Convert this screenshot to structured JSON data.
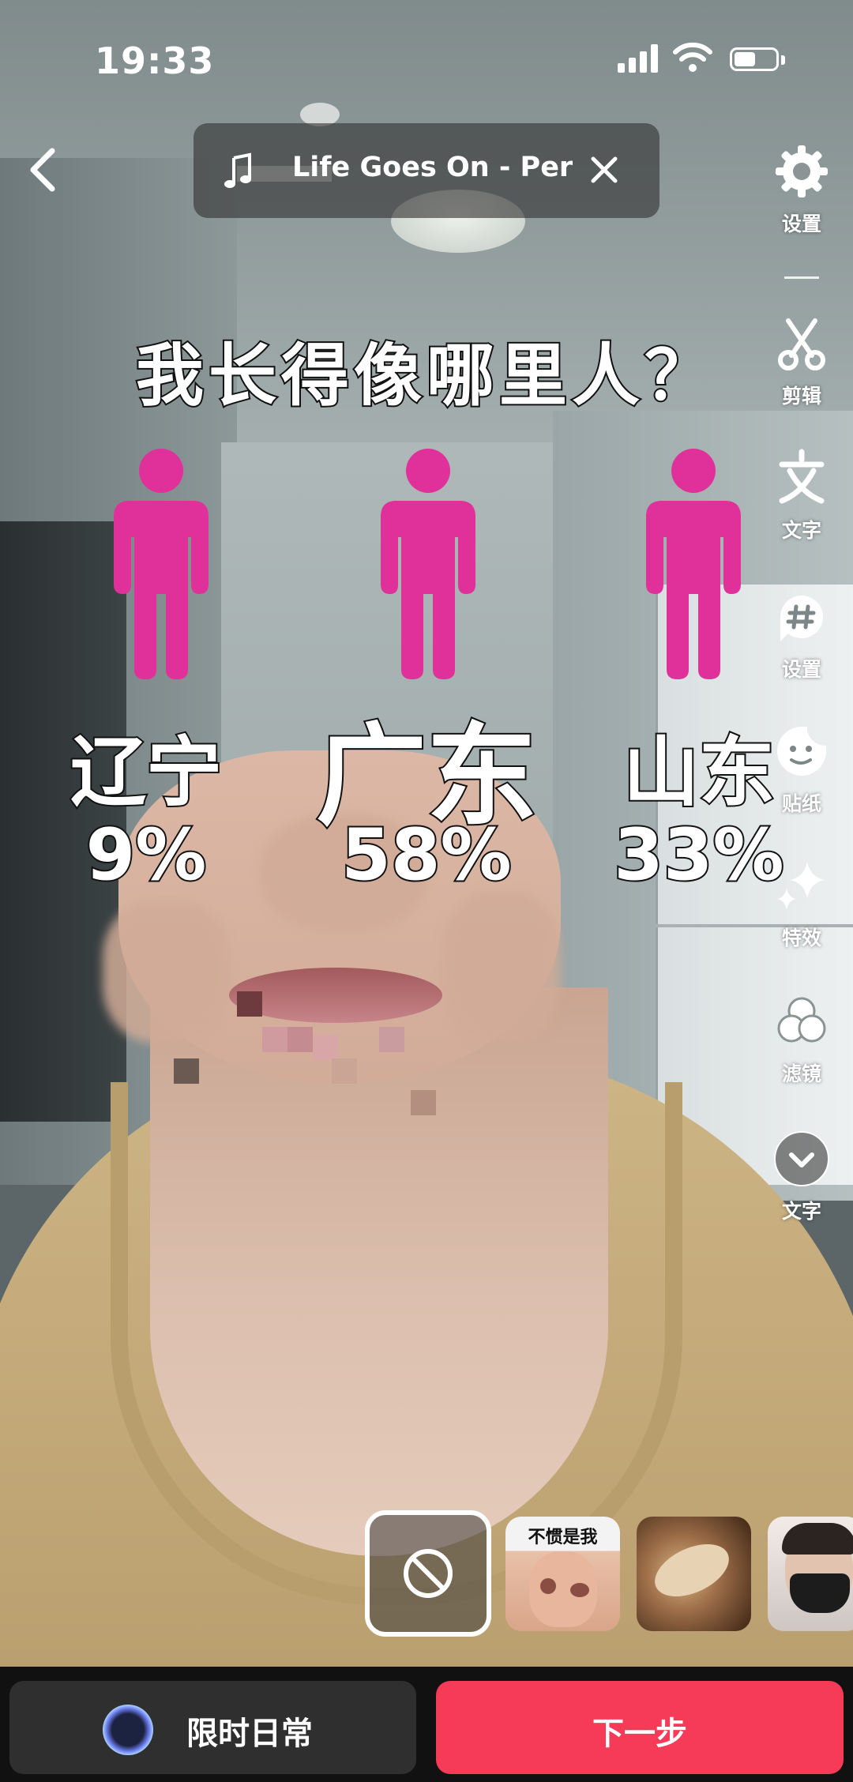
{
  "status_bar": {
    "time": "19:33"
  },
  "music": {
    "title": "Life Goes On - Per"
  },
  "tools": [
    {
      "label": "设置",
      "icon": "gear-icon"
    },
    {
      "label": "剪辑",
      "icon": "scissors-icon"
    },
    {
      "label": "文字",
      "icon": "text-icon"
    },
    {
      "label": "设置",
      "icon": "hashtag-icon"
    },
    {
      "label": "贴纸",
      "icon": "sticker-icon"
    },
    {
      "label": "特效",
      "icon": "sparkle-icon"
    },
    {
      "label": "滤镜",
      "icon": "filter-icon"
    },
    {
      "label": "文字",
      "icon": "chevron-down-icon"
    }
  ],
  "effect": {
    "title": "我长得像哪里人？",
    "figure_color": "#e0309a",
    "results": [
      {
        "region": "辽宁",
        "percent": "9%"
      },
      {
        "region": "广东",
        "percent": "58%"
      },
      {
        "region": "山东",
        "percent": "33%"
      }
    ]
  },
  "thumbnails": [
    {
      "label": "不惯是我"
    }
  ],
  "bottom": {
    "daily_label": "限时日常",
    "next_label": "下一步",
    "next_color": "#f53b57"
  }
}
